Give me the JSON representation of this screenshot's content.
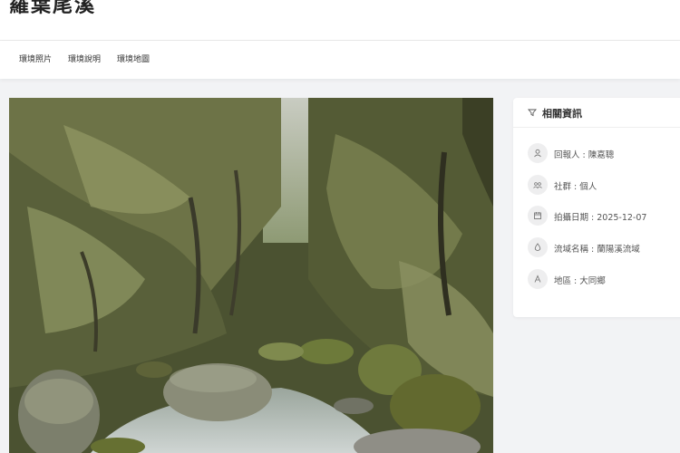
{
  "page": {
    "title": "羅葉尾溪"
  },
  "tabs": [
    {
      "label": "環境照片"
    },
    {
      "label": "環境說明"
    },
    {
      "label": "環境地圖"
    }
  ],
  "photo": {
    "description_icon": "photo"
  },
  "info": {
    "title": "相關資訊",
    "title_icon": "filter-icon",
    "rows": [
      {
        "icon": "user-icon",
        "text": "回報人 : 陳嘉聰"
      },
      {
        "icon": "group-icon",
        "text": "社群 : 個人"
      },
      {
        "icon": "calendar-icon",
        "text": "拍攝日期 : 2025-12-07"
      },
      {
        "icon": "water-drop-icon",
        "text": "流域名稱 : 蘭陽溪流域"
      },
      {
        "icon": "region-icon",
        "text": "地區 : 大同鄉"
      }
    ]
  },
  "colors": {
    "background": "#f2f3f5",
    "card": "#ffffff",
    "icon_circle": "#eeeeef"
  }
}
